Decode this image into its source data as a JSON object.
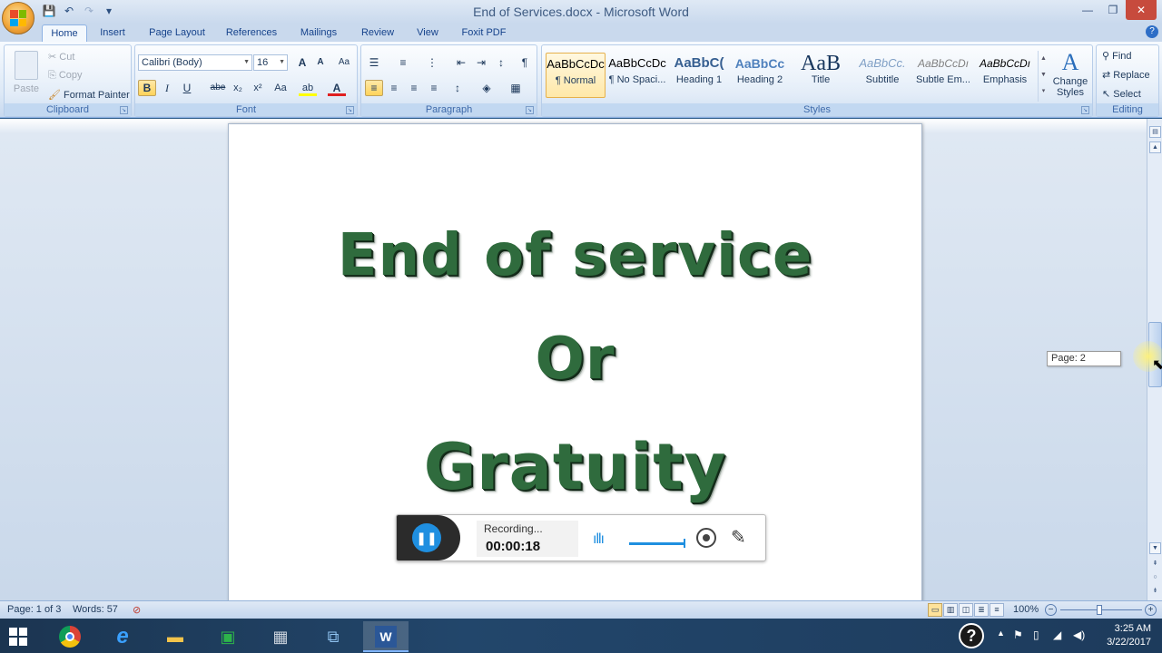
{
  "window": {
    "title": "End of Services.docx - Microsoft Word",
    "controls": {
      "minimize": "—",
      "maximize": "❐",
      "close": "✕"
    }
  },
  "qat": {
    "save": "💾",
    "undo": "↶",
    "redo": "↷",
    "more": "▾"
  },
  "tabs": [
    "Home",
    "Insert",
    "Page Layout",
    "References",
    "Mailings",
    "Review",
    "View",
    "Foxit PDF"
  ],
  "active_tab": "Home",
  "ribbon": {
    "clipboard": {
      "label": "Clipboard",
      "paste": "Paste",
      "cut": "Cut",
      "copy": "Copy",
      "format_painter": "Format Painter"
    },
    "font": {
      "label": "Font",
      "font_name": "Calibri (Body)",
      "font_size": "16",
      "grow": "A",
      "shrink": "A",
      "clear": "Aa",
      "bold": "B",
      "italic": "I",
      "underline": "U",
      "strike": "abe",
      "subscript": "x₂",
      "superscript": "x²",
      "change_case": "Aa",
      "highlight": "ab",
      "font_color": "A"
    },
    "paragraph": {
      "label": "Paragraph",
      "show_marks": "¶"
    },
    "styles": {
      "label": "Styles",
      "items": [
        {
          "sample": "AaBbCcDc",
          "name": "¶ Normal"
        },
        {
          "sample": "AaBbCcDc",
          "name": "¶ No Spaci..."
        },
        {
          "sample": "AaBbC(",
          "name": "Heading 1"
        },
        {
          "sample": "AaBbCc",
          "name": "Heading 2"
        },
        {
          "sample": "AaB",
          "name": "Title"
        },
        {
          "sample": "AaBbCc.",
          "name": "Subtitle"
        },
        {
          "sample": "AaBbCcDı",
          "name": "Subtle Em..."
        },
        {
          "sample": "AaBbCcDı",
          "name": "Emphasis"
        }
      ],
      "change_styles": "Change Styles"
    },
    "editing": {
      "label": "Editing",
      "find": "Find",
      "replace": "Replace",
      "select": "Select"
    }
  },
  "document": {
    "wordart_lines": [
      "End of service",
      "Or",
      "Gratuity"
    ]
  },
  "scroll_tooltip": "Page: 2",
  "recorder": {
    "status": "Recording...",
    "time": "00:00:18"
  },
  "statusbar": {
    "page": "Page: 1 of 3",
    "words": "Words: 57",
    "zoom": "100%"
  },
  "taskbar": {
    "time": "3:25 AM",
    "date": "3/22/2017",
    "help": "?"
  }
}
